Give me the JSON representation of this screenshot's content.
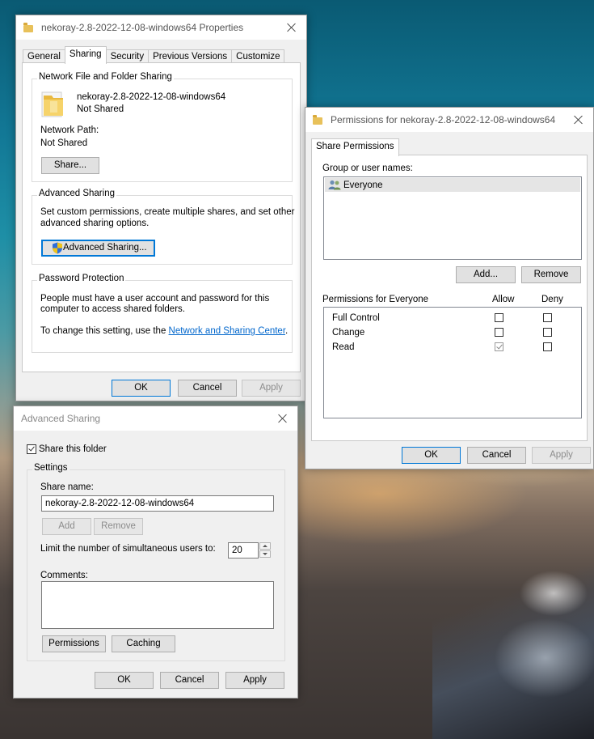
{
  "properties_window": {
    "title": "nekoray-2.8-2022-12-08-windows64 Properties",
    "tabs": [
      "General",
      "Sharing",
      "Security",
      "Previous Versions",
      "Customize"
    ],
    "active_tab": "Sharing",
    "network_sharing": {
      "group_title": "Network File and Folder Sharing",
      "folder_name": "nekoray-2.8-2022-12-08-windows64",
      "status": "Not Shared",
      "network_path_label": "Network Path:",
      "network_path_value": "Not Shared",
      "share_button": "Share..."
    },
    "advanced_sharing": {
      "group_title": "Advanced Sharing",
      "description_line1": "Set custom permissions, create multiple shares, and set other",
      "description_line2": "advanced sharing options.",
      "button": "Advanced Sharing..."
    },
    "password_protection": {
      "group_title": "Password Protection",
      "line1": "People must have a user account and password for this",
      "line2": "computer to access shared folders.",
      "line3_prefix": "To change this setting, use the ",
      "link": "Network and Sharing Center",
      "line3_suffix": "."
    },
    "buttons": {
      "ok": "OK",
      "cancel": "Cancel",
      "apply": "Apply"
    }
  },
  "permissions_window": {
    "title": "Permissions for nekoray-2.8-2022-12-08-windows64",
    "tab": "Share Permissions",
    "group_label": "Group or user names:",
    "users": [
      "Everyone"
    ],
    "add_button": "Add...",
    "remove_button": "Remove",
    "permissions_label": "Permissions for Everyone",
    "allow_header": "Allow",
    "deny_header": "Deny",
    "permissions": [
      {
        "name": "Full Control",
        "allow": false,
        "deny": false
      },
      {
        "name": "Change",
        "allow": false,
        "deny": false
      },
      {
        "name": "Read",
        "allow": true,
        "deny": false
      }
    ],
    "buttons": {
      "ok": "OK",
      "cancel": "Cancel",
      "apply": "Apply"
    }
  },
  "advanced_window": {
    "title": "Advanced Sharing",
    "share_checkbox_label": "Share this folder",
    "share_checked": true,
    "settings_title": "Settings",
    "share_name_label": "Share name:",
    "share_name_value": "nekoray-2.8-2022-12-08-windows64",
    "add_button": "Add",
    "remove_button": "Remove",
    "limit_label": "Limit the number of simultaneous users to:",
    "limit_value": "20",
    "comments_label": "Comments:",
    "permissions_button": "Permissions",
    "caching_button": "Caching",
    "buttons": {
      "ok": "OK",
      "cancel": "Cancel",
      "apply": "Apply"
    }
  }
}
